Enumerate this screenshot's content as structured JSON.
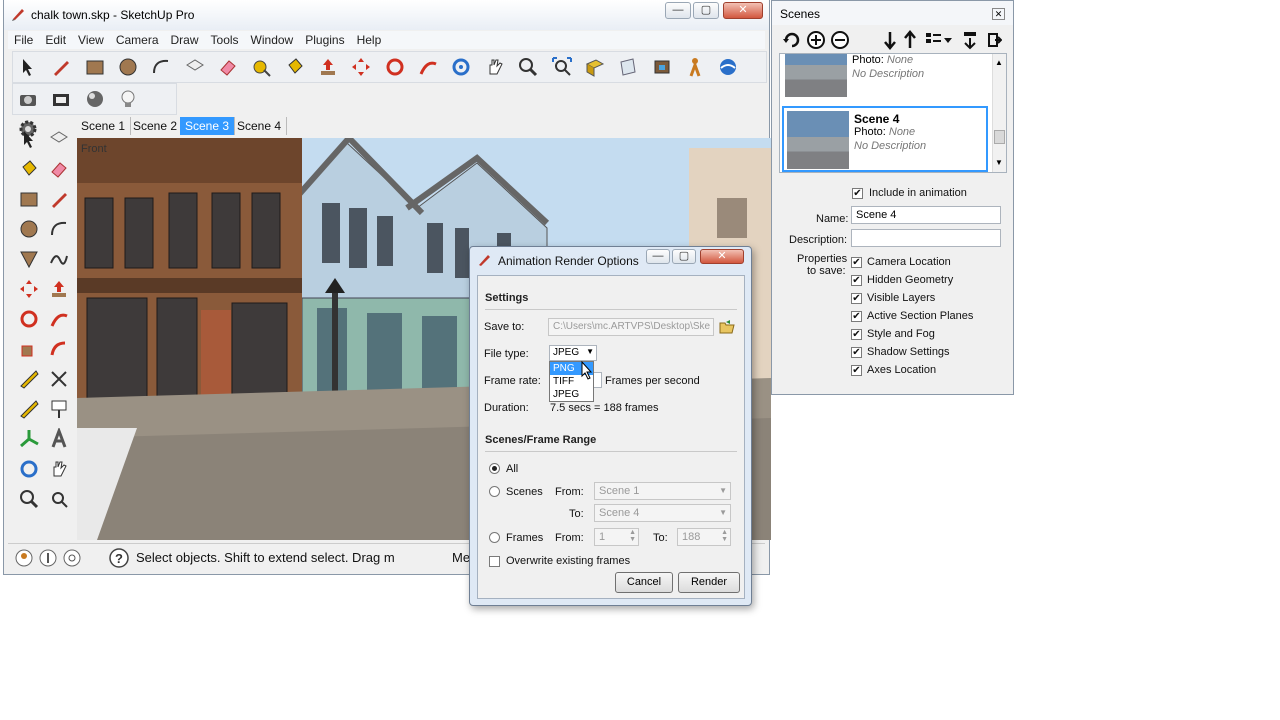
{
  "main_window": {
    "title": "chalk town.skp - SketchUp Pro",
    "min": "—",
    "max": "▢",
    "close": "✕",
    "menu": [
      "File",
      "Edit",
      "View",
      "Camera",
      "Draw",
      "Tools",
      "Window",
      "Plugins",
      "Help"
    ],
    "scene_tabs": [
      "Scene 1",
      "Scene 2",
      "Scene 3",
      "Scene 4"
    ],
    "active_scene_tab": 2,
    "viewport_label": "Front",
    "status_text": "Select objects. Shift to extend select. Drag m",
    "status_measure": "Me"
  },
  "scenes_panel": {
    "title": "Scenes",
    "close": "✕",
    "prev_scene": {
      "photo_label": "Photo:",
      "photo_value": "None",
      "description": "No Description"
    },
    "selected_scene": {
      "name": "Scene 4",
      "photo_label": "Photo:",
      "photo_value": "None",
      "description": "No Description"
    },
    "include_label": "Include in animation",
    "name_label": "Name:",
    "name_value": "Scene 4",
    "description_label": "Description:",
    "description_value": "",
    "properties_label_1": "Properties",
    "properties_label_2": "to save:",
    "properties": [
      "Camera Location",
      "Hidden Geometry",
      "Visible Layers",
      "Active Section Planes",
      "Style and Fog",
      "Shadow Settings",
      "Axes Location"
    ]
  },
  "dialog": {
    "title": "Animation Render Options",
    "settings_heading": "Settings",
    "save_to_label": "Save to:",
    "save_to_value": "C:\\Users\\mc.ARTVPS\\Desktop\\Ske",
    "file_type_label": "File type:",
    "file_type_value": "JPEG",
    "file_type_options": [
      "PNG",
      "TIFF",
      "JPEG"
    ],
    "file_type_highlight": 0,
    "frame_rate_label": "Frame rate:",
    "frame_rate_unit": "Frames per second",
    "duration_label": "Duration:",
    "duration_value": "7.5 secs = 188 frames",
    "range_heading": "Scenes/Frame Range",
    "all_label": "All",
    "scenes_label": "Scenes",
    "from_label": "From:",
    "to_label": "To:",
    "scenes_from": "Scene 1",
    "scenes_to": "Scene 4",
    "frames_label": "Frames",
    "frames_from": "1",
    "frames_to": "188",
    "overwrite_label": "Overwrite existing frames",
    "cancel": "Cancel",
    "render": "Render"
  },
  "colors": {
    "accent": "#3399ff",
    "title_bar": "#e9eef5",
    "dialog_frame": "#dfe9f5"
  }
}
